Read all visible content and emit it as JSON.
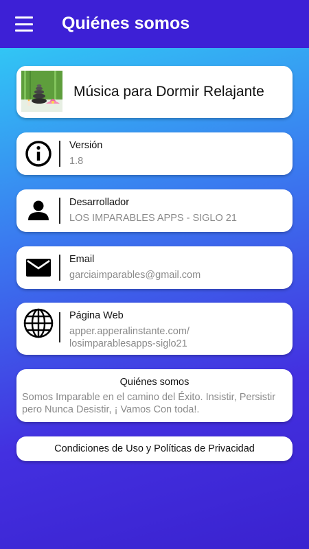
{
  "appbar": {
    "title": "Quiénes somos",
    "menu_icon": "hamburger-menu-icon"
  },
  "app": {
    "name": "Música para Dormir Relajante",
    "thumbnail": "zen-stones-lotus-image"
  },
  "info": {
    "version": {
      "label": "Versión",
      "value": "1.8",
      "icon": "info-circle-icon"
    },
    "developer": {
      "label": "Desarrollador",
      "value": "LOS IMPARABLES APPS - SIGLO 21",
      "icon": "person-icon"
    },
    "email": {
      "label": "Email",
      "value": "garciaimparables@gmail.com",
      "icon": "mail-icon"
    },
    "website": {
      "label": "Página Web",
      "value_line1": "apper.apperalinstante.com/",
      "value_line2": "losimparablesapps-siglo21",
      "icon": "globe-icon"
    }
  },
  "about": {
    "title": "Quiénes somos",
    "text": "Somos Imparable en el camino del Éxito. Insistir, Persistir pero Nunca Desistir, ¡ Vamos Con toda!."
  },
  "terms": {
    "label": "Condiciones de Uso y Políticas de Privacidad"
  },
  "colors": {
    "appbar": "#3d20d6",
    "gradient_top": "#2fd8f6",
    "gradient_bottom": "#3a22cf"
  }
}
